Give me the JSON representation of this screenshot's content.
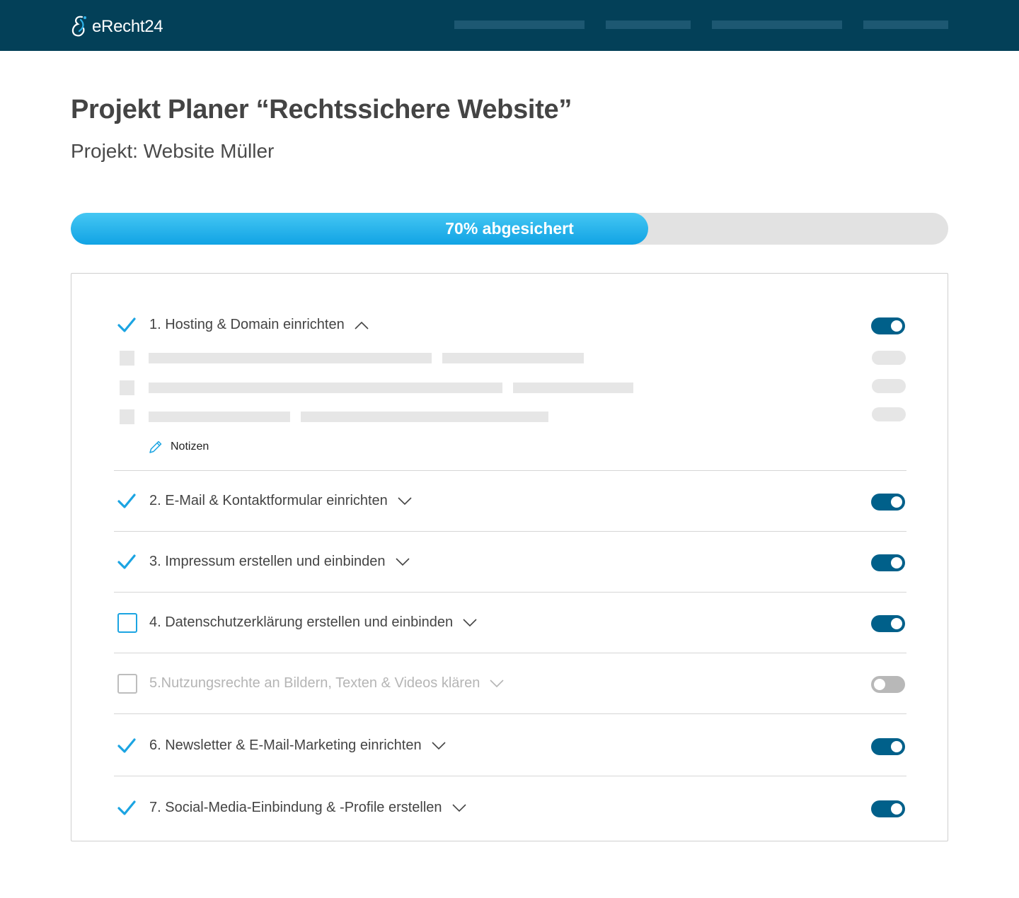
{
  "header": {
    "brand": "eRecht24",
    "background": "#034058"
  },
  "page": {
    "title": "Projekt Planer “Rechtssichere Website”",
    "subtitle": "Projekt: Website Müller"
  },
  "progress": {
    "value_percent": 70,
    "label": "70% abgesichert",
    "fill_color": "#11a3e4"
  },
  "checklist": {
    "expanded_notes_label": "Notizen",
    "items": [
      {
        "label": "1. Hosting & Domain einrichten",
        "checked": true,
        "toggle_on": true,
        "expanded": true,
        "disabled": false
      },
      {
        "label": "2. E-Mail & Kontaktformular einrichten",
        "checked": true,
        "toggle_on": true,
        "expanded": false,
        "disabled": false
      },
      {
        "label": "3. Impressum erstellen und einbinden",
        "checked": true,
        "toggle_on": true,
        "expanded": false,
        "disabled": false
      },
      {
        "label": "4. Datenschutzerklärung erstellen und einbinden",
        "checked": false,
        "toggle_on": true,
        "expanded": false,
        "disabled": false
      },
      {
        "label": "5.Nutzungsrechte an Bildern, Texten & Videos klären",
        "checked": false,
        "toggle_on": false,
        "expanded": false,
        "disabled": true
      },
      {
        "label": "6. Newsletter & E-Mail-Marketing einrichten",
        "checked": true,
        "toggle_on": true,
        "expanded": false,
        "disabled": false
      },
      {
        "label": "7. Social-Media-Einbindung & -Profile erstellen",
        "checked": true,
        "toggle_on": true,
        "expanded": false,
        "disabled": false
      }
    ]
  },
  "colors": {
    "accent": "#1ba4e2",
    "toggle_on": "#00608a",
    "toggle_off": "#b8b8b8"
  }
}
